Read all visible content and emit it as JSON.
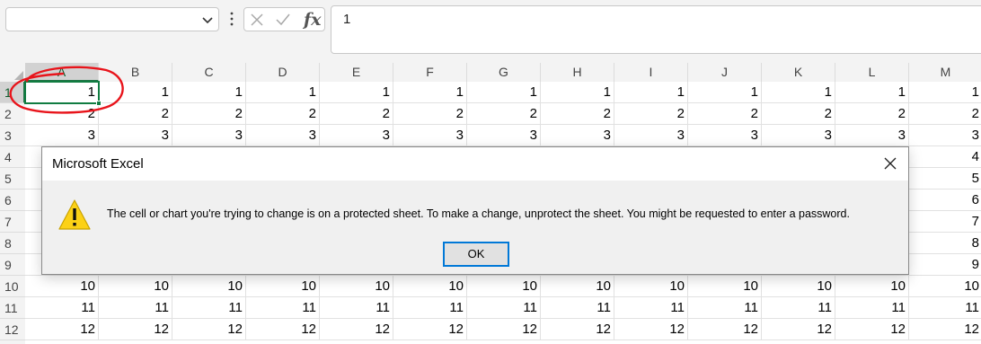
{
  "formula_bar": {
    "name_box_value": "",
    "formula_value": "1",
    "fx_label": "fx",
    "icons": [
      "chevron-down-icon",
      "more-options-icon",
      "cancel-icon",
      "enter-check-icon",
      "insert-function-icon"
    ]
  },
  "sheet": {
    "columns": [
      "A",
      "B",
      "C",
      "D",
      "E",
      "F",
      "G",
      "H",
      "I",
      "J",
      "K",
      "L",
      "M"
    ],
    "rows": [
      {
        "header": "1",
        "cells": [
          "1",
          "1",
          "1",
          "1",
          "1",
          "1",
          "1",
          "1",
          "1",
          "1",
          "1",
          "1",
          "1"
        ]
      },
      {
        "header": "2",
        "cells": [
          "2",
          "2",
          "2",
          "2",
          "2",
          "2",
          "2",
          "2",
          "2",
          "2",
          "2",
          "2",
          "2"
        ]
      },
      {
        "header": "3",
        "cells": [
          "3",
          "3",
          "3",
          "3",
          "3",
          "3",
          "3",
          "3",
          "3",
          "3",
          "3",
          "3",
          "3"
        ]
      },
      {
        "header": "4",
        "cells": [
          "",
          "",
          "",
          "",
          "",
          "",
          "",
          "",
          "",
          "",
          "",
          "",
          "4"
        ]
      },
      {
        "header": "5",
        "cells": [
          "",
          "",
          "",
          "",
          "",
          "",
          "",
          "",
          "",
          "",
          "",
          "",
          "5"
        ]
      },
      {
        "header": "6",
        "cells": [
          "",
          "",
          "",
          "",
          "",
          "",
          "",
          "",
          "",
          "",
          "",
          "",
          "6"
        ]
      },
      {
        "header": "7",
        "cells": [
          "",
          "",
          "",
          "",
          "",
          "",
          "",
          "",
          "",
          "",
          "",
          "",
          "7"
        ]
      },
      {
        "header": "8",
        "cells": [
          "",
          "",
          "",
          "",
          "",
          "",
          "",
          "",
          "",
          "",
          "",
          "",
          "8"
        ]
      },
      {
        "header": "9",
        "cells": [
          "",
          "",
          "",
          "",
          "",
          "",
          "",
          "",
          "",
          "",
          "",
          "",
          "9"
        ]
      },
      {
        "header": "10",
        "cells": [
          "10",
          "10",
          "10",
          "10",
          "10",
          "10",
          "10",
          "10",
          "10",
          "10",
          "10",
          "10",
          "10"
        ]
      },
      {
        "header": "11",
        "cells": [
          "11",
          "11",
          "11",
          "11",
          "11",
          "11",
          "11",
          "11",
          "11",
          "11",
          "11",
          "11",
          "11"
        ]
      },
      {
        "header": "12",
        "cells": [
          "12",
          "12",
          "12",
          "12",
          "12",
          "12",
          "12",
          "12",
          "12",
          "12",
          "12",
          "12",
          "12"
        ]
      }
    ],
    "selected_column": "A",
    "selected_row": "1",
    "accent_color": "#107c41",
    "annotation_color": "#e8141b"
  },
  "dialog": {
    "title": "Microsoft Excel",
    "message": "The cell or chart you're trying to change is on a protected sheet. To make a change, unprotect the sheet. You might be requested to enter a password.",
    "ok_label": "OK",
    "icon": "warning-icon",
    "close_icon": "close-icon"
  }
}
